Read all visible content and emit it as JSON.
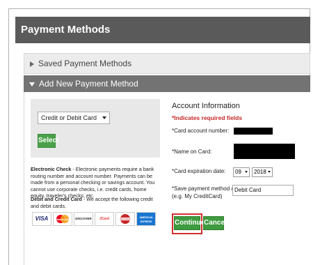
{
  "header": {
    "title": "Payment Methods"
  },
  "saved_section": {
    "label": "Saved Payment Methods"
  },
  "new_section": {
    "label": "Add New Payment Method"
  },
  "payment_type": {
    "selected": "Credit or Debit Card",
    "select_button": "Select"
  },
  "electronic_check": {
    "title": "Electronic Check",
    "text": " - Electronic payments require a bank routing number and account number. Payments can be made from a personal checking or savings account. You cannot use corporate checks, i.e. credit cards, home equity, traveler's checks, etc."
  },
  "debit_credit": {
    "title": "Debit and Credit Card",
    "text": " - We accept the following credit and debit cards."
  },
  "card_logos": [
    {
      "label": "VISA",
      "color": "#1a1f71"
    },
    {
      "label": "MasterCard",
      "color": "#eb001b"
    },
    {
      "label": "DISCOVER",
      "color": "#f58220"
    },
    {
      "label": "JCard",
      "color": "#e53935"
    },
    {
      "label": "DinersClub",
      "color": "#c62828"
    },
    {
      "label": "AMERICAN EXPRESS",
      "color": "#1976d2"
    }
  ],
  "account": {
    "title": "Account Information",
    "required_note": "*Indicates required fields",
    "card_number_label": "*Card account number:",
    "name_label": "*Name on Card:",
    "expiration_label": "*Card expiration date:",
    "exp_month": "09",
    "exp_year": "2018",
    "save_label": "*Save payment method as:",
    "save_hint": "(e.g. My CreditCard)",
    "save_value": "Debit Card",
    "continue_button": "Continue",
    "cancel_button": "Cancel"
  },
  "colors": {
    "header_bg": "#5a5a5a",
    "accent_green": "#3e9b3e",
    "required_red": "#c62828",
    "highlight_red": "#d32f2f"
  }
}
